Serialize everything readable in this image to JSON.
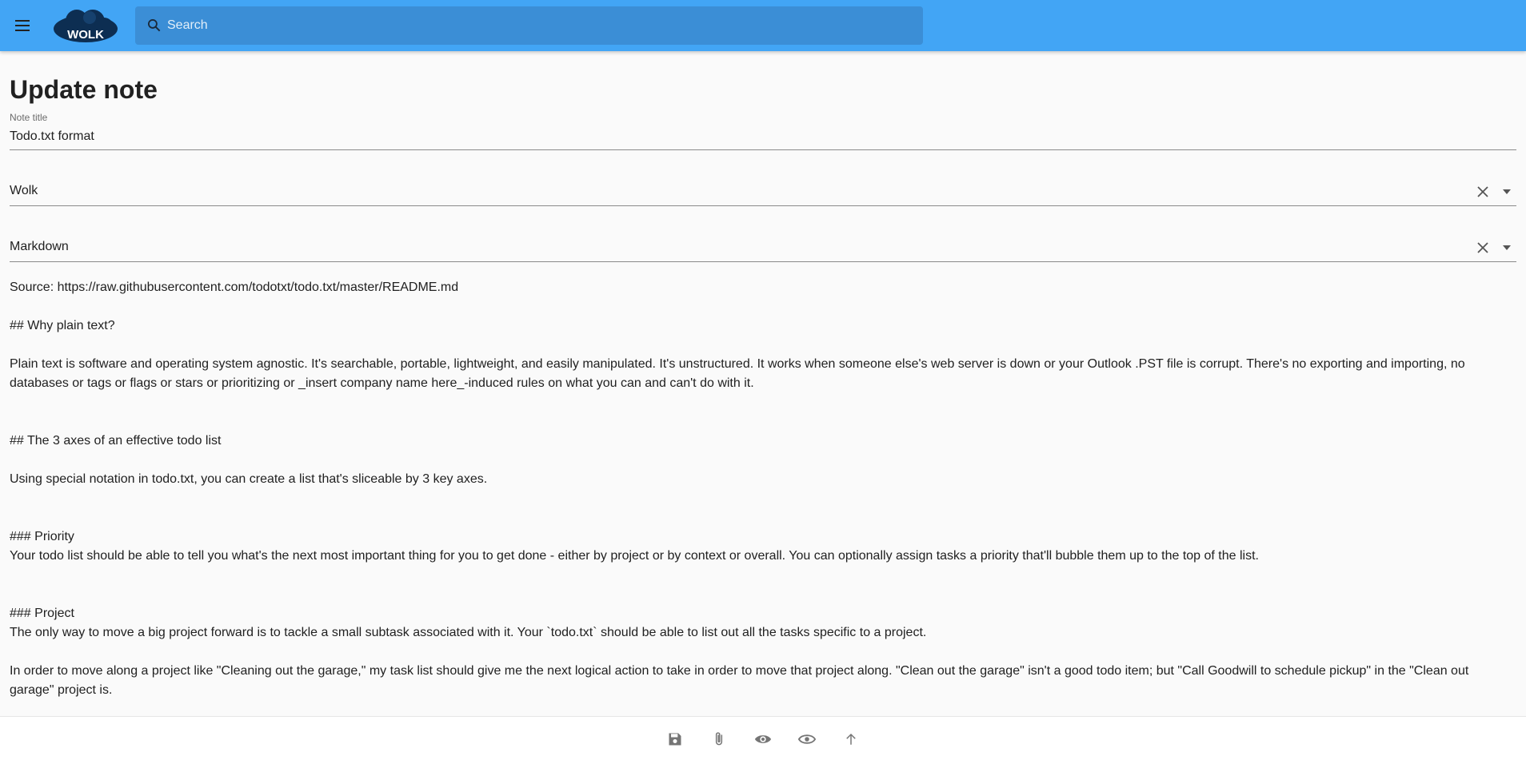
{
  "app": {
    "logo_text": "WOLK"
  },
  "search": {
    "placeholder": "Search"
  },
  "page": {
    "title": "Update note"
  },
  "form": {
    "title_label": "Note title",
    "title_value": "Todo.txt format",
    "notebook_value": "Wolk",
    "format_value": "Markdown"
  },
  "note": {
    "lines": [
      "Source: https://raw.githubusercontent.com/todotxt/todo.txt/master/README.md",
      "",
      "## Why plain text?",
      "",
      "Plain text is software and operating system agnostic. It's searchable, portable, lightweight, and easily manipulated. It's unstructured. It works when someone else's web server is down or your Outlook .PST file is corrupt. There's no exporting and importing, no databases or tags or flags or stars or prioritizing or _insert company name here_-induced rules on what you can and can't do with it.",
      "",
      "",
      "## The 3 axes of an effective todo list",
      "",
      "Using special notation in todo.txt, you can create a list that's sliceable by 3 key axes.",
      "",
      "",
      "### Priority",
      "Your todo list should be able to tell you what's the next most important thing for you to get done - either by project or by context or overall. You can optionally assign tasks a priority that'll bubble them up to the top of the list.",
      "",
      "",
      "### Project",
      "The only way to move a big project forward is to tackle a small subtask associated with it. Your `todo.txt` should be able to list out all the tasks specific to a project.",
      "",
      "In order to move along a project like \"Cleaning out the garage,\" my task list should give me the next logical action to take in order to move that project along. \"Clean out the garage\" isn't a good todo item; but \"Call Goodwill to schedule pickup\" in the \"Clean out garage\" project is."
    ]
  },
  "toolbar": {
    "icons": [
      "save-icon",
      "attach-icon",
      "preview-icon",
      "view-icon",
      "scroll-top-icon"
    ]
  },
  "colors": {
    "header_bg": "#42a5f5",
    "search_bg": "#3b8ed6",
    "page_bg": "#fafafa",
    "icon_grey": "#757575",
    "logo_dark": "#0d2e52"
  }
}
